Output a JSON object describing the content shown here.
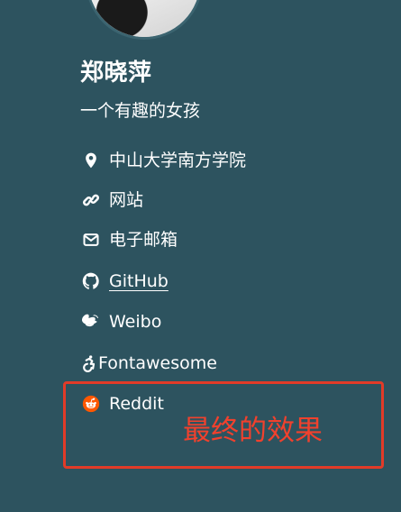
{
  "profile": {
    "name": "郑晓萍",
    "bio": "一个有趣的女孩"
  },
  "links": [
    {
      "label": "中山大学南方学院",
      "icon": "location-pin-icon"
    },
    {
      "label": "网站",
      "icon": "link-icon"
    },
    {
      "label": "电子邮箱",
      "icon": "envelope-icon"
    },
    {
      "label": " GitHub",
      "icon": "github-icon"
    },
    {
      "label": "Weibo",
      "icon": "weibo-icon"
    },
    {
      "label": "Fontawesome",
      "icon": "accessibility-icon"
    },
    {
      "label": "Reddit",
      "icon": "reddit-icon"
    }
  ],
  "annotation": {
    "text": "最终的效果",
    "color": "#f1412d"
  },
  "colors": {
    "background": "#2d535f",
    "reddit": "#ff5700",
    "annotation_border": "#e23b28"
  }
}
